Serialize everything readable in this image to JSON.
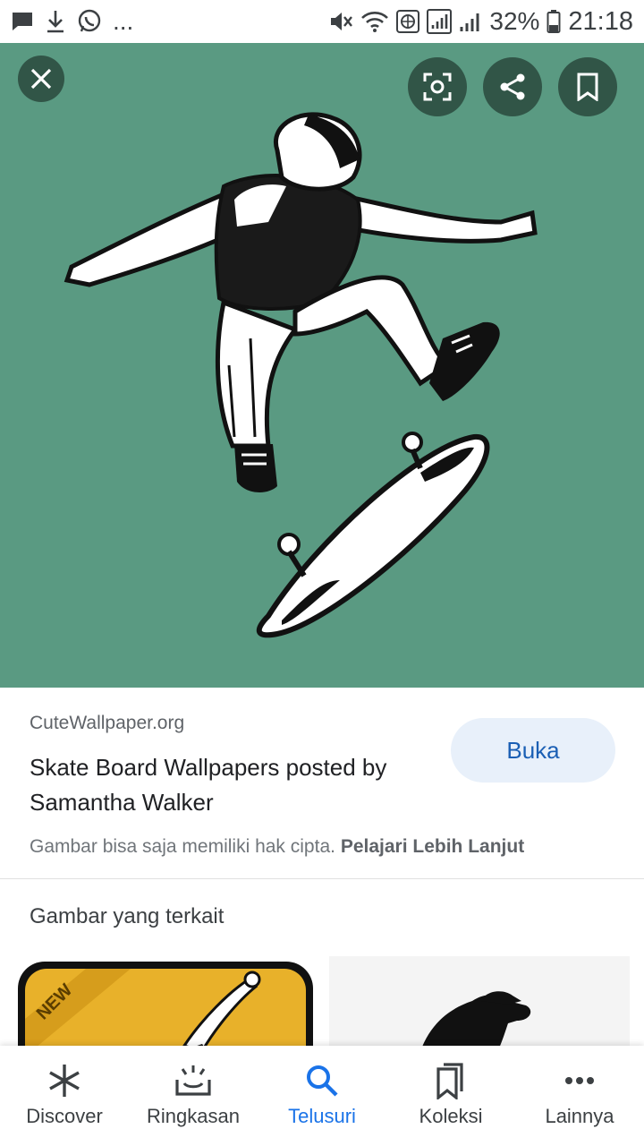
{
  "status_bar": {
    "left_icons": [
      "message-icon",
      "download-icon",
      "whatsapp-icon"
    ],
    "more": "...",
    "battery": "32%",
    "time": "21:18"
  },
  "hero": {
    "background": "#5a9a82",
    "actions": [
      "close-icon",
      "lens-icon",
      "share-icon",
      "bookmark-icon"
    ]
  },
  "result": {
    "source": "CuteWallpaper.org",
    "title": "Skate Board Wallpapers posted by Samantha Walker",
    "open_label": "Buka",
    "copyright_text": "Gambar bisa saja memiliki hak cipta.",
    "learn_more": "Pelajari Lebih Lanjut"
  },
  "related": {
    "heading": "Gambar yang terkait",
    "badge": "NEW"
  },
  "bottom_nav": {
    "items": [
      {
        "label": "Discover",
        "icon": "asterisk-icon"
      },
      {
        "label": "Ringkasan",
        "icon": "tray-icon"
      },
      {
        "label": "Telusuri",
        "icon": "search-icon",
        "active": true
      },
      {
        "label": "Koleksi",
        "icon": "collections-icon"
      },
      {
        "label": "Lainnya",
        "icon": "more-icon"
      }
    ]
  },
  "colors": {
    "accent": "#1a73e8",
    "open_button_bg": "#e8f0fa"
  }
}
